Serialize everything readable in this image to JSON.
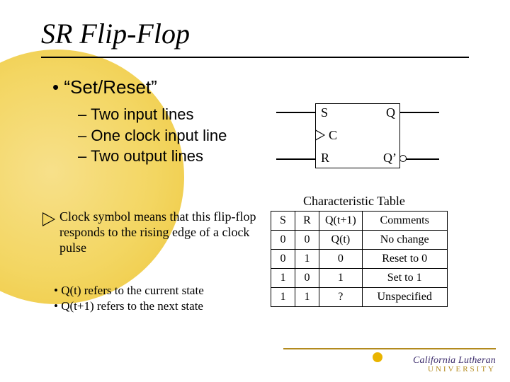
{
  "title": "SR Flip-Flop",
  "bullets": {
    "main": "“Set/Reset”",
    "subs": [
      "Two input lines",
      "One clock input line",
      "Two output lines"
    ]
  },
  "ff": {
    "s": "S",
    "r": "R",
    "c": "C",
    "q": "Q",
    "qp": "Q’"
  },
  "clock_note": "Clock symbol means that this flip-flop responds to the rising edge of a clock pulse",
  "state_notes": [
    "Q(t) refers to the current state",
    "Q(t+1) refers to the next state"
  ],
  "char": {
    "caption": "Characteristic Table",
    "headers": [
      "S",
      "R",
      "Q(t+1)",
      "Comments"
    ],
    "rows": [
      [
        "0",
        "0",
        "Q(t)",
        "No change"
      ],
      [
        "0",
        "1",
        "0",
        "Reset to 0"
      ],
      [
        "1",
        "0",
        "1",
        "Set to 1"
      ],
      [
        "1",
        "1",
        "?",
        "Unspecified"
      ]
    ]
  },
  "logo": {
    "top": "California Lutheran",
    "bot": "UNIVERSITY"
  },
  "chart_data": {
    "type": "table",
    "title": "Characteristic Table",
    "columns": [
      "S",
      "R",
      "Q(t+1)",
      "Comments"
    ],
    "rows": [
      {
        "S": 0,
        "R": 0,
        "Q(t+1)": "Q(t)",
        "Comments": "No change"
      },
      {
        "S": 0,
        "R": 1,
        "Q(t+1)": 0,
        "Comments": "Reset to 0"
      },
      {
        "S": 1,
        "R": 0,
        "Q(t+1)": 1,
        "Comments": "Set to 1"
      },
      {
        "S": 1,
        "R": 1,
        "Q(t+1)": "?",
        "Comments": "Unspecified"
      }
    ]
  }
}
